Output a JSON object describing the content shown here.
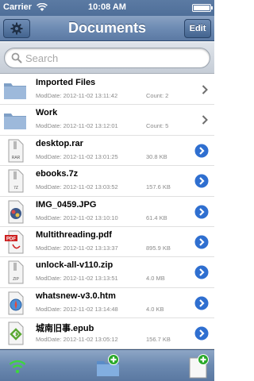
{
  "status_bar": {
    "carrier": "Carrier",
    "time": "10:08 AM"
  },
  "nav": {
    "title": "Documents",
    "edit_label": "Edit"
  },
  "search": {
    "placeholder": "Search"
  },
  "files": [
    {
      "name": "Imported Files",
      "modified": "ModDate: 2012-11-02 13:11:42",
      "size": "Count: 2",
      "kind": "folder",
      "accessory": "chevron"
    },
    {
      "name": "Work",
      "modified": "ModDate: 2012-11-02 13:12:01",
      "size": "Count: 5",
      "kind": "folder",
      "accessory": "chevron"
    },
    {
      "name": "desktop.rar",
      "modified": "ModDate: 2012-11-02 13:01:25",
      "size": "30.8 KB",
      "kind": "rar",
      "icon_label": "RAR",
      "accessory": "disclosure"
    },
    {
      "name": "ebooks.7z",
      "modified": "ModDate: 2012-11-02 13:03:52",
      "size": "157.6 KB",
      "kind": "7z",
      "icon_label": "7Z",
      "accessory": "disclosure"
    },
    {
      "name": "IMG_0459.JPG",
      "modified": "ModDate: 2012-11-02 13:10:10",
      "size": "61.4 KB",
      "kind": "image",
      "accessory": "disclosure"
    },
    {
      "name": "Multithreading.pdf",
      "modified": "ModDate: 2012-11-02 13:13:37",
      "size": "895.9 KB",
      "kind": "pdf",
      "icon_label": "PDF",
      "accessory": "disclosure"
    },
    {
      "name": "unlock-all-v110.zip",
      "modified": "ModDate: 2012-11-02 13:13:51",
      "size": "4.0 MB",
      "kind": "zip",
      "icon_label": "ZIP",
      "accessory": "disclosure"
    },
    {
      "name": "whatsnew-v3.0.htm",
      "modified": "ModDate: 2012-11-02 13:14:48",
      "size": "4.0 KB",
      "kind": "html",
      "accessory": "disclosure"
    },
    {
      "name": "城南旧事.epub",
      "modified": "ModDate: 2012-11-02 13:05:12",
      "size": "156.7 KB",
      "kind": "epub",
      "accessory": "disclosure"
    }
  ],
  "toolbar": {
    "wifi_icon": "wifi-icon",
    "new_folder_icon": "new-folder-icon",
    "new_file_icon": "new-file-icon"
  },
  "colors": {
    "nav_blue": "#6d8bb3",
    "disclosure_blue": "#2f6fd0",
    "pdf_red": "#cc1f1f",
    "epub_green": "#5aa832"
  }
}
